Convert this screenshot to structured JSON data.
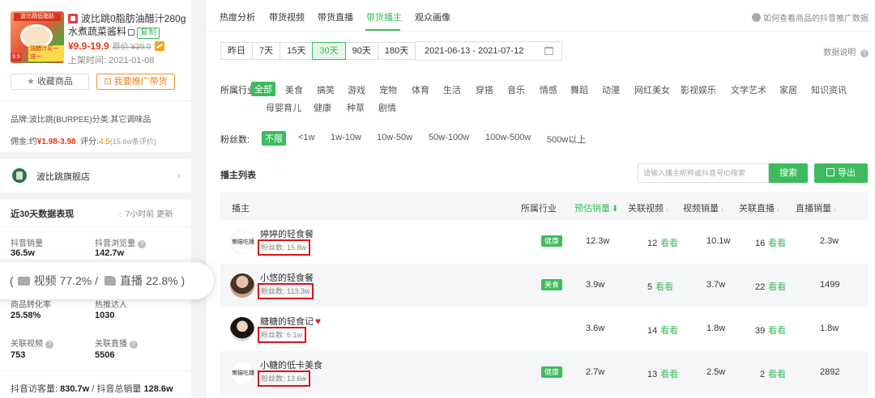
{
  "product": {
    "title": "波比跳0脂肪油醋汁280g水煮蔬菜酱料",
    "copy_label": "复制",
    "price": "¥9.9-19.9",
    "orig_label": "原价:",
    "orig_price": "¥39.9",
    "listed_label": "上架时间:",
    "listed_date": "2021-01-08",
    "img_banner": "波比跳低脂肪",
    "img_tag1": "9.9",
    "img_tag2": "油醋汁买一送一",
    "fav_label": "收藏商品",
    "promo_label": "我要推广带货"
  },
  "info": {
    "brand_label": "品牌:",
    "brand_value": "波比跳(BURPEE)",
    "cat_label": "分类:",
    "cat_value": "其它调味品",
    "comm_label": "佣金:",
    "comm_prefix": "约",
    "comm_value": "¥1.98-3.98",
    "rating_label": "评分:",
    "rating_value": "4.5",
    "rating_count": "(15.6w条评价)"
  },
  "shop": {
    "name": "波比跳旗舰店"
  },
  "perf": {
    "title": "近30天数据表现",
    "update": "7小时前 更新",
    "stats": [
      {
        "label": "抖音销量",
        "value": "36.5w"
      },
      {
        "label": "抖音浏览量",
        "value": "142.7w"
      },
      {
        "label": "商品转化率",
        "value": "25.58%"
      },
      {
        "label": "热推达人",
        "value": "1030"
      },
      {
        "label": "关联视频",
        "value": "753"
      },
      {
        "label": "关联直播",
        "value": "5506"
      }
    ],
    "visitors_label": "抖音访客量:",
    "visitors_value": "830.7w",
    "sep": "/",
    "total_label": "抖音总销量",
    "total_value": "128.6w"
  },
  "bubble": {
    "open": "(",
    "video_label": "视频",
    "video_pct": "77.2%",
    "slash": "/",
    "live_label": "直播",
    "live_pct": "22.8%",
    "close": ")"
  },
  "tabs": [
    "热度分析",
    "带货视频",
    "带货直播",
    "带货播主",
    "观众画像"
  ],
  "help": "如何查看商品的抖音推广数据",
  "ranges": [
    "昨日",
    "7天",
    "15天",
    "30天",
    "90天",
    "180天"
  ],
  "date_range": "2021-06-13  -  2021-07-12",
  "data_info": "数据说明",
  "industry_label": "所属行业:",
  "industries_row1": [
    "全部",
    "美食",
    "搞笑",
    "游戏",
    "宠物",
    "体育",
    "生活",
    "穿搭",
    "音乐",
    "情感",
    "舞蹈",
    "动漫",
    "网红美女",
    "影视娱乐",
    "文学艺术",
    "家居",
    "知识资讯"
  ],
  "industries_row2": [
    "母婴育儿",
    "健康",
    "种草",
    "剧情"
  ],
  "fans_label": "粉丝数:",
  "fan_ranges": [
    "不限",
    "<1w",
    "1w-10w",
    "10w-50w",
    "50w-100w",
    "100w-500w",
    "500w以上"
  ],
  "list": {
    "title": "播主列表",
    "search_placeholder": "请输入播主昵称或抖音号ID搜索",
    "search_btn": "搜索",
    "export_btn": "导出",
    "view_label": "看看",
    "headers": [
      "播主",
      "所属行业",
      "预估销量",
      "关联视频",
      "视频销量",
      "关联直播",
      "直播销量"
    ],
    "rows": [
      {
        "avatar_text": "懒猫吃播",
        "name": "婷婷的轻食餐",
        "fans": "粉丝数: 15.8w",
        "industry": "健康",
        "est": "12.3w",
        "videos": "12",
        "video_sales": "10.1w",
        "lives": "16",
        "live_sales": "2.3w"
      },
      {
        "avatar_text": "",
        "name": "小悠的轻食餐",
        "fans": "粉丝数: 113.3w",
        "industry": "美食",
        "est": "3.9w",
        "videos": "5",
        "video_sales": "3.7w",
        "lives": "22",
        "live_sales": "1499"
      },
      {
        "avatar_text": "",
        "name": "糖糖的轻食记",
        "fans": "粉丝数: 6.1w",
        "industry": "",
        "est": "3.6w",
        "videos": "14",
        "video_sales": "1.8w",
        "lives": "39",
        "live_sales": "1.8w"
      },
      {
        "avatar_text": "懒猫吃播",
        "name": "小糖的低卡美食",
        "fans": "粉丝数: 13.6w",
        "industry": "健康",
        "est": "2.7w",
        "videos": "13",
        "video_sales": "2.5w",
        "lives": "2",
        "live_sales": "2892"
      }
    ]
  },
  "colors": {
    "accent": "#3dbb5e",
    "price": "#e8380d",
    "highlight_box": "#d9131c",
    "promo": "#f08015"
  }
}
